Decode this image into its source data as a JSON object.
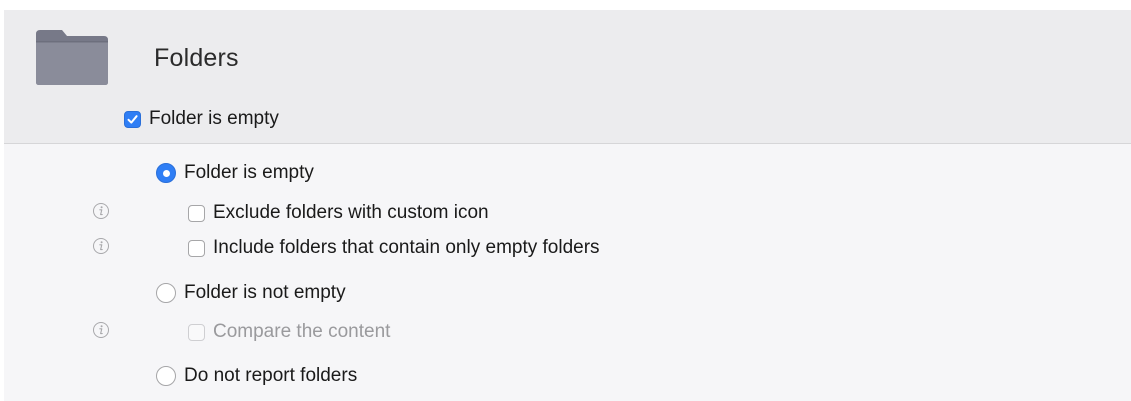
{
  "header": {
    "title": "Folders",
    "icon": "folder-icon",
    "empty_checkbox": {
      "label": "Folder is empty",
      "checked": true
    }
  },
  "options": [
    {
      "label": "Folder is empty",
      "selected": true,
      "type": "radio"
    },
    {
      "label": "Exclude folders with custom icon",
      "checked": false,
      "type": "checkbox",
      "info": true
    },
    {
      "label": "Include folders that contain only empty folders",
      "checked": false,
      "type": "checkbox",
      "info": true
    },
    {
      "label": "Folder is not empty",
      "selected": false,
      "type": "radio"
    },
    {
      "label": "Compare the content",
      "checked": false,
      "disabled": true,
      "type": "checkbox",
      "info": true
    },
    {
      "label": "Do not report folders",
      "selected": false,
      "type": "radio"
    }
  ],
  "colors": {
    "accent": "#2f7ef5",
    "header_bg": "#ececee",
    "panel_bg": "#f6f6f8",
    "folder": "#7f8190"
  }
}
